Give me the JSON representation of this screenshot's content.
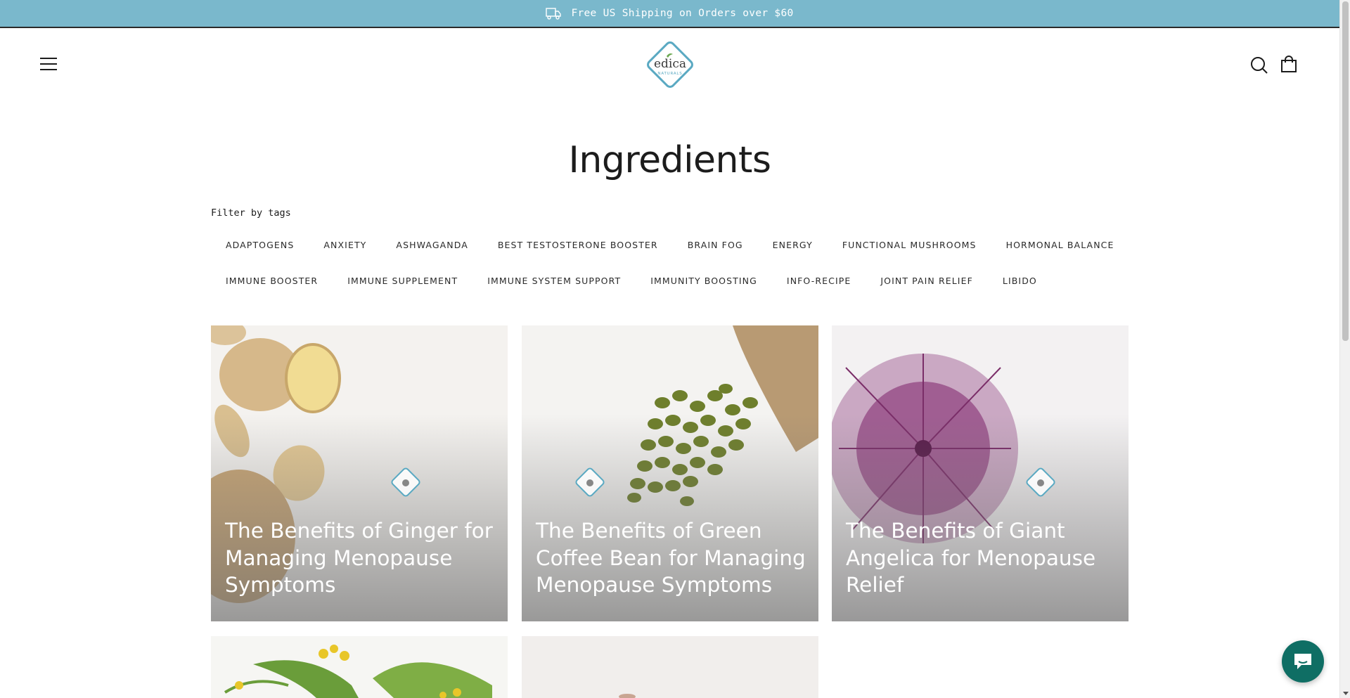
{
  "announcement": {
    "text": "Free US Shipping on Orders over $60",
    "icon": "truck-icon"
  },
  "header": {
    "menu_icon": "hamburger-menu-icon",
    "logo": {
      "word": "edica",
      "sub": "NATURALS"
    },
    "search_icon": "search-icon",
    "cart_icon": "shopping-bag-icon"
  },
  "page": {
    "title": "Ingredients"
  },
  "filter": {
    "label": "Filter by tags",
    "tags_row1": [
      "ADAPTOGENS",
      "ANXIETY",
      "ASHWAGANDA",
      "BEST TESTOSTERONE BOOSTER",
      "BRAIN FOG",
      "ENERGY",
      "FUNCTIONAL MUSHROOMS",
      "HORMONAL BALANCE"
    ],
    "tags_row2": [
      "IMMUNE BOOSTER",
      "IMMUNE SUPPLEMENT",
      "IMMUNE SYSTEM SUPPORT",
      "IMMUNITY BOOSTING",
      "INFO-RECIPE",
      "JOINT PAIN RELIEF",
      "LIBIDO"
    ]
  },
  "articles": [
    {
      "title": "The Benefits of Ginger for Managing Menopause Symptoms"
    },
    {
      "title": "The Benefits of Green Coffee Bean for Managing Menopause Symptoms"
    },
    {
      "title": "The Benefits of Giant Angelica for Menopause Relief"
    }
  ],
  "colors": {
    "announcement_bg": "#7ab8cc",
    "logo_teal": "#5aa9c2",
    "chat_bg": "#0f6e64"
  },
  "chat": {
    "icon": "chat-bubble-icon"
  }
}
